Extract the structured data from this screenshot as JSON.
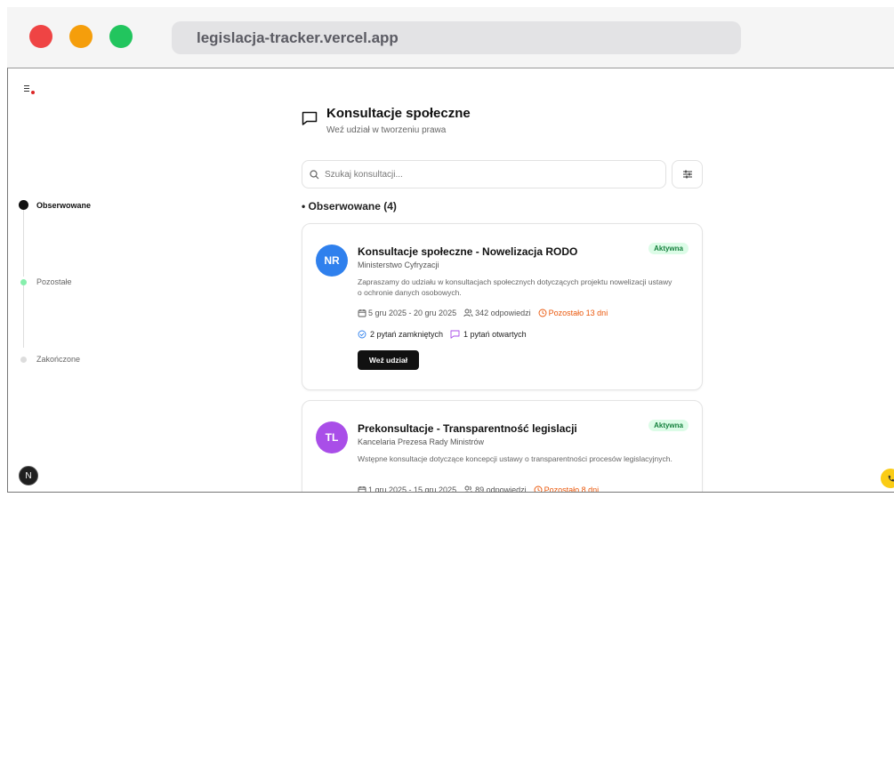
{
  "browser": {
    "url": "legislacja-tracker.vercel.app"
  },
  "header": {
    "title": "Konsultacje społeczne",
    "subtitle": "Weź udział w tworzeniu prawa"
  },
  "search": {
    "placeholder": "Szukaj konsultacji..."
  },
  "timeline": {
    "items": [
      {
        "label": "Obserwowane",
        "active": true
      },
      {
        "label": "Pozostałe",
        "active": false
      },
      {
        "label": "Zakończone",
        "active": false
      }
    ]
  },
  "section": {
    "title": "• Obserwowane (4)"
  },
  "consultations": [
    {
      "initials": "NR",
      "avatar_color": "#2f80ed",
      "title": "Konsultacje społeczne - Nowelizacja RODO",
      "org": "Ministerstwo Cyfryzacji",
      "description": "Zapraszamy do udziału w konsultacjach społecznych dotyczących projektu nowelizacji ustawy o ochronie danych osobowych.",
      "status": "Aktywna",
      "dates": "5 gru 2025 - 20 gru 2025",
      "responses": "342 odpowiedzi",
      "remaining": "Pozostało 13 dni",
      "closed_questions": "2 pytań zamkniętych",
      "open_questions": "1 pytań otwartych",
      "action": "Weź udział"
    },
    {
      "initials": "TL",
      "avatar_color": "#a94ee8",
      "title": "Prekonsultacje - Transparentność legislacji",
      "org": "Kancelaria Prezesa Rady Ministrów",
      "description": "Wstępne konsultacje dotyczące koncepcji ustawy o transparentności procesów legislacyjnych.",
      "status": "Aktywna",
      "dates": "1 gru 2025 - 15 gru 2025",
      "responses": "89 odpowiedzi",
      "remaining": "Pozostało 8 dni"
    }
  ],
  "dev_badge": {
    "label": "N"
  },
  "colors": {
    "accent": "#111111",
    "active_badge_bg": "#dcfce7",
    "active_badge_text": "#15803d",
    "remaining": "#ea580c",
    "timeline_dot": "#86efac"
  }
}
